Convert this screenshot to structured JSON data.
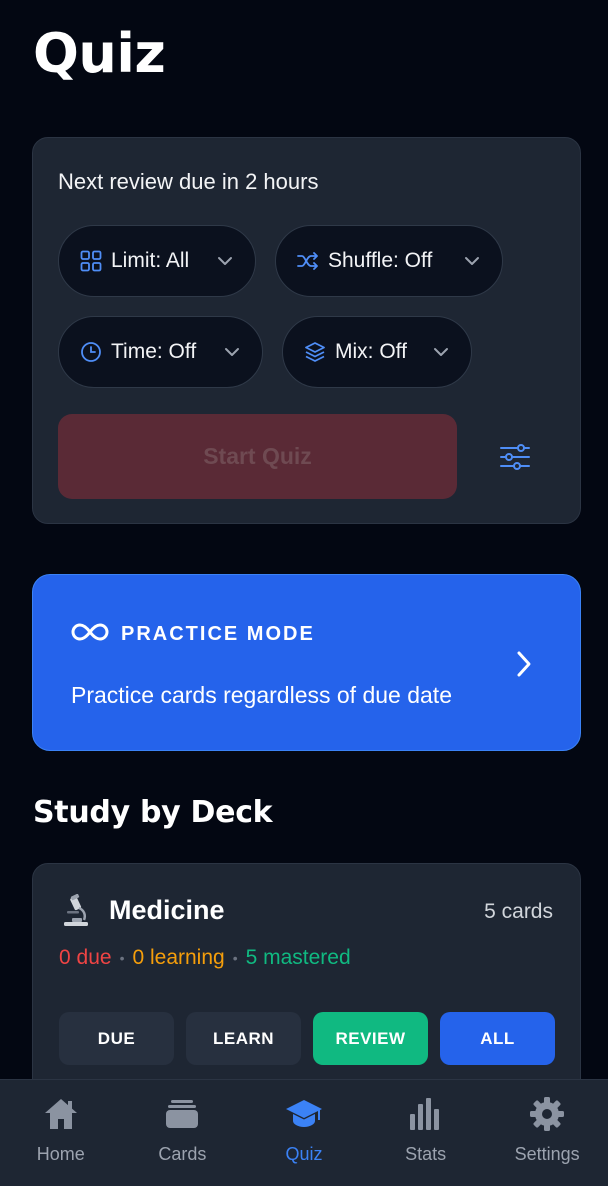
{
  "page": {
    "title": "Quiz"
  },
  "review": {
    "next_due_text": "Next review due in 2 hours",
    "limit_label": "Limit: All",
    "shuffle_label": "Shuffle: Off",
    "time_label": "Time: Off",
    "mix_label": "Mix: Off",
    "start_label": "Start Quiz"
  },
  "practice": {
    "title": "PRACTICE MODE",
    "description": "Practice cards regardless of due date"
  },
  "study": {
    "section_title": "Study by Deck",
    "decks": [
      {
        "name": "Medicine",
        "count": "5 cards",
        "due": "0 due",
        "learning": "0 learning",
        "mastered": "5 mastered",
        "buttons": {
          "due": "DUE",
          "learn": "LEARN",
          "review": "REVIEW",
          "all": "ALL"
        }
      }
    ]
  },
  "tabs": [
    {
      "label": "Home",
      "icon": "home-icon"
    },
    {
      "label": "Cards",
      "icon": "cards-icon"
    },
    {
      "label": "Quiz",
      "icon": "graduation-cap-icon",
      "active": true
    },
    {
      "label": "Stats",
      "icon": "bar-chart-icon"
    },
    {
      "label": "Settings",
      "icon": "gear-icon"
    }
  ],
  "colors": {
    "background": "#030712",
    "card": "#1e2633",
    "accent_blue": "#2563eb",
    "danger": "#ef4444",
    "warning": "#f59e0b",
    "success": "#10b981",
    "start_disabled": "#5a2a36"
  }
}
